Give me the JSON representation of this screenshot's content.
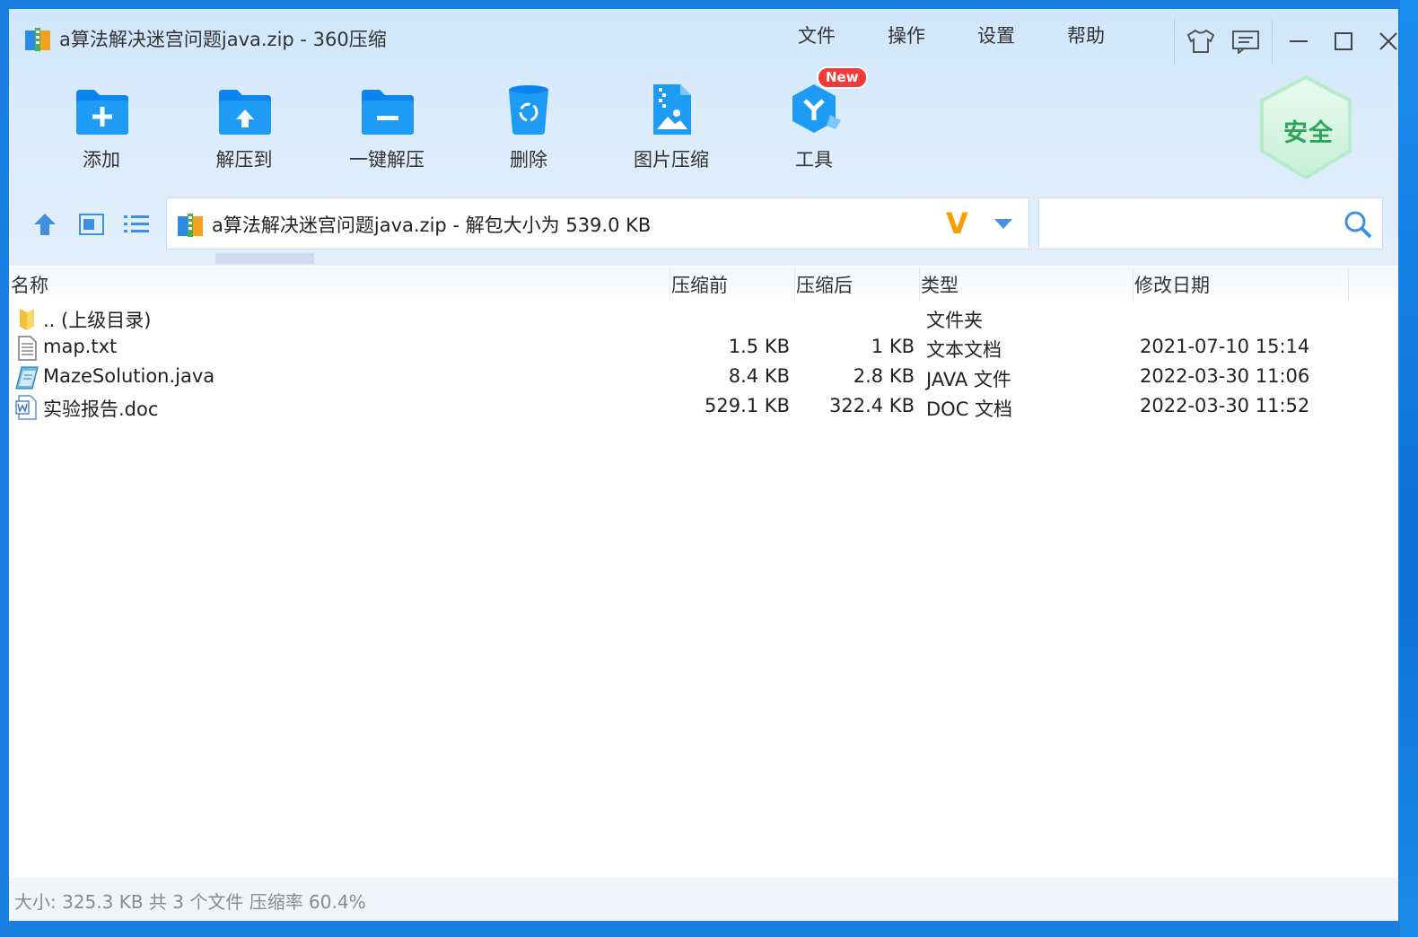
{
  "window": {
    "title": "a算法解决迷宫问题java.zip - 360压缩"
  },
  "menu": {
    "items": [
      "文件",
      "操作",
      "设置",
      "帮助"
    ]
  },
  "toolbar": {
    "add": "添加",
    "extract_to": "解压到",
    "one_click_extract": "一键解压",
    "delete": "删除",
    "image_compress": "图片压缩",
    "tools": "工具",
    "new_badge": "New",
    "security_badge": "安全"
  },
  "address": {
    "text": "a算法解决迷宫问题java.zip - 解包大小为 539.0 KB",
    "vip_mark": "V"
  },
  "search": {
    "value": "",
    "placeholder": ""
  },
  "columns": {
    "name": "名称",
    "before": "压缩前",
    "after": "压缩后",
    "type": "类型",
    "date": "修改日期"
  },
  "files": [
    {
      "icon": "parent-folder-icon",
      "name": ".. (上级目录)",
      "before": "",
      "after": "",
      "type": "文件夹",
      "date": ""
    },
    {
      "icon": "text-file-icon",
      "name": "map.txt",
      "before": "1.5 KB",
      "after": "1 KB",
      "type": "文本文档",
      "date": "2021-07-10 15:14"
    },
    {
      "icon": "java-file-icon",
      "name": "MazeSolution.java",
      "before": "8.4 KB",
      "after": "2.8 KB",
      "type": "JAVA 文件",
      "date": "2022-03-30 11:06"
    },
    {
      "icon": "word-doc-icon",
      "name": "实验报告.doc",
      "before": "529.1 KB",
      "after": "322.4 KB",
      "type": "DOC 文档",
      "date": "2022-03-30 11:52"
    }
  ],
  "status": {
    "text": "大小: 325.3 KB 共 3 个文件 压缩率 60.4%"
  },
  "colors": {
    "accent": "#1a8df0",
    "header_bg": "#d6e9fb",
    "badge_red": "#f23a3a",
    "safe_green": "#2aa55b"
  }
}
